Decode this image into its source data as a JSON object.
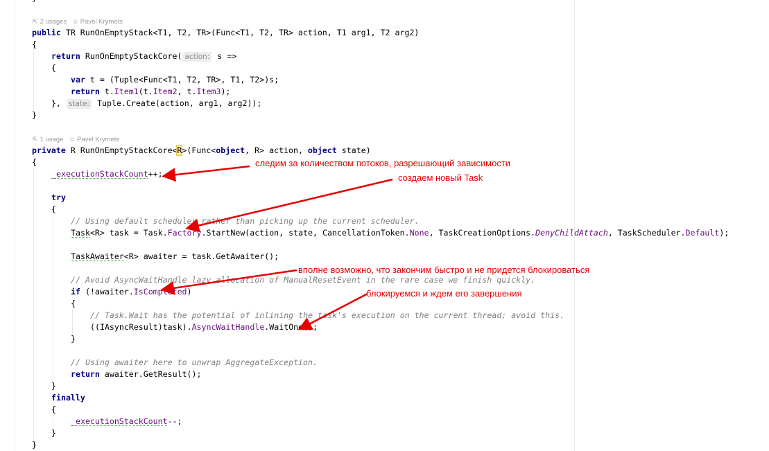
{
  "usage_meta": {
    "first": {
      "usages": "2 usages",
      "author": "Pavel Krymets"
    },
    "second": {
      "usages": "1 usage",
      "author": "Pavel Krymets"
    }
  },
  "code": {
    "l1_kw": "public",
    "l1_rest": " TR RunOnEmptyStack<T1, T2, TR>(Func<T1, T2, TR> action, T1 arg1, T2 arg2)",
    "brace_open": "{",
    "brace_close": "}",
    "l3_kw": "return",
    "l3_call": " RunOnEmptyStackCore(",
    "l3_hint": "action:",
    "l3_rest": " s =>",
    "l5_kw": "var",
    "l5_rest": " t = (Tuple<Func<T1, T2, TR>, T1, T2>)s;",
    "l6_kw": "return",
    "l6_a": " t.",
    "l6_item1": "Item1",
    "l6_b": "(t.",
    "l6_item2": "Item2",
    "l6_c": ", t.",
    "l6_item3": "Item3",
    "l6_d": ");",
    "l7_a": "},",
    "l7_hint": "state:",
    "l7_rest": " Tuple.Create(action, arg1, arg2));",
    "l9_kw": "private",
    "l9_a": " R RunOnEmptyStackCore<",
    "l9_r": "R",
    "l9_b": ">(Func<",
    "l9_obj": "object",
    "l9_c": ", R> action, ",
    "l9_obj2": "object",
    "l9_d": " state)",
    "l11_a": "_executionStackCount",
    "l11_b": "++;",
    "try": "try",
    "c1": "// Using default scheduler rather than picking up the current scheduler.",
    "l14_task": "Task",
    "l14_a": "<R> task = Task.",
    "l14_factory": "Factory",
    "l14_b": ".StartNew(action, state, CancellationToken.",
    "l14_none": "None",
    "l14_c": ", TaskCreationOptions.",
    "l14_deny": "DenyChildAttach",
    "l14_d": ", TaskScheduler.",
    "l14_default": "Default",
    "l14_e": ");",
    "l16_aw": "TaskAwaiter",
    "l16_rest": "<R> awaiter = task.GetAwaiter();",
    "c2": "// Avoid AsyncWaitHandle lazy allocation of ManualResetEvent in the rare case we finish quickly.",
    "l18_kw": "if",
    "l18_a": " (!awaiter.",
    "l18_completed": "IsCompleted",
    "l18_b": ")",
    "c3": "// Task.Wait has the potential of inlining the task's execution on the current thread; avoid this.",
    "l21_a": "((IAsyncResult)task).",
    "l21_handle": "AsyncWaitHandle",
    "l21_b": ".WaitOne();",
    "c4": "// Using awaiter here to unwrap AggregateException.",
    "l25_kw": "return",
    "l25_rest": " awaiter.GetResult();",
    "finally": "finally",
    "l29_a": "_executionStackCount",
    "l29_b": "--;"
  },
  "annotations": {
    "a1": "следим за количеством потоков, разрешающий зависимости",
    "a2": "создаем новый Task",
    "a3": "вполне возможно, что закончим быстро и не придется блокироваться",
    "a4": "блокируемся и ждем его завершения"
  },
  "colors": {
    "keyword": "#000080",
    "member": "#660e7a",
    "comment": "#808080",
    "annotation": "#e50000"
  }
}
